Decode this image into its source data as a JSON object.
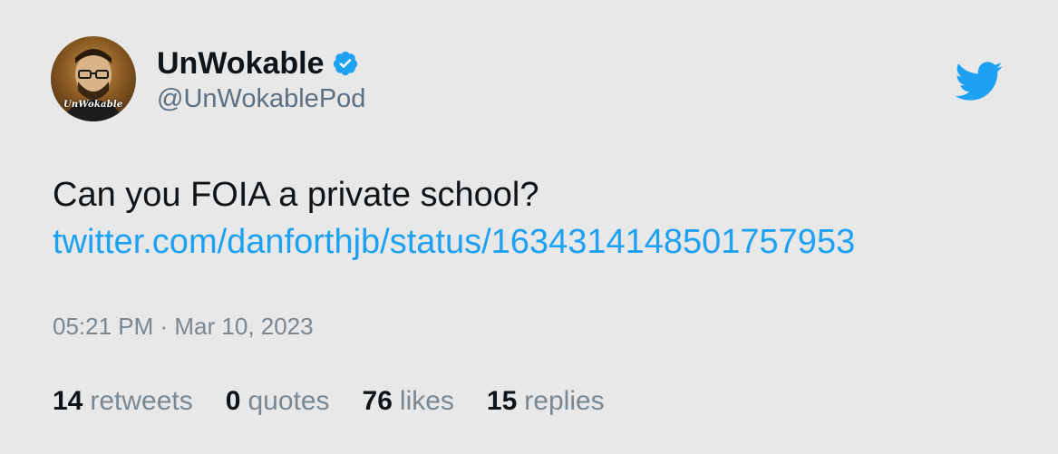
{
  "author": {
    "display_name": "UnWokable",
    "handle": "@UnWokablePod",
    "avatar_text": "UnWokable",
    "verified": true
  },
  "tweet": {
    "text": "Can you FOIA a private school?",
    "link": "twitter.com/danforthjb/status/1634314148501757953",
    "timestamp": "05:21 PM · Mar 10, 2023"
  },
  "stats": [
    {
      "count": "14",
      "label": "retweets"
    },
    {
      "count": "0",
      "label": "quotes"
    },
    {
      "count": "76",
      "label": "likes"
    },
    {
      "count": "15",
      "label": "replies"
    }
  ],
  "colors": {
    "background": "#e8e8e8",
    "link": "#1da1f2",
    "brand": "#1da1f2",
    "muted": "#7a8791"
  },
  "icons": {
    "verified": "verified-badge-icon",
    "brand": "twitter-bird-icon"
  }
}
